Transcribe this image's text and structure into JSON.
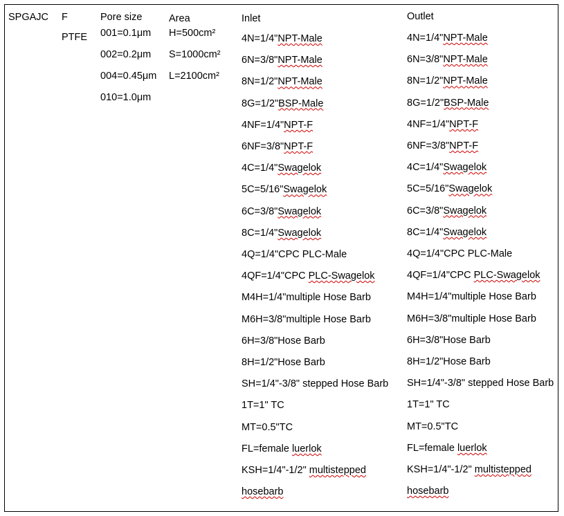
{
  "model": "SPGAJC",
  "material": {
    "code": "F",
    "name": "PTFE"
  },
  "pore_size": {
    "header": "Pore size",
    "items": [
      "001=0.1μm",
      "002=0.2μm",
      "004=0.45μm",
      "010=1.0μm"
    ]
  },
  "area": {
    "header": "Area",
    "items": [
      "H=500cm²",
      "S=1000cm²",
      "L=2100cm²"
    ]
  },
  "inlet": {
    "header": "Inlet",
    "items": [
      {
        "pre": "4N=1/4\"",
        "spell": "NPT-Male",
        "post": ""
      },
      {
        "pre": "6N=3/8\"",
        "spell": "NPT-Male",
        "post": ""
      },
      {
        "pre": "8N=1/2\"",
        "spell": "NPT-Male",
        "post": ""
      },
      {
        "pre": "8G=1/2\"",
        "spell": "BSP-Male",
        "post": ""
      },
      {
        "pre": "4NF=1/4\"",
        "spell": "NPT-F",
        "post": ""
      },
      {
        "pre": "6NF=3/8\"",
        "spell": "NPT-F",
        "post": ""
      },
      {
        "pre": "4C=1/4\"",
        "spell": "Swagelok",
        "post": ""
      },
      {
        "pre": "5C=5/16\"",
        "spell": "Swagelok",
        "post": ""
      },
      {
        "pre": "6C=3/8\"",
        "spell": "Swagelok",
        "post": ""
      },
      {
        "pre": "8C=1/4\"",
        "spell": "Swagelok",
        "post": ""
      },
      {
        "pre": "4Q=1/4\"CPC PLC-Male",
        "spell": "",
        "post": ""
      },
      {
        "pre": "4QF=1/4\"CPC ",
        "spell": "PLC-Swagelok",
        "post": ""
      },
      {
        "pre": "M4H=1/4\"multiple Hose Barb",
        "spell": "",
        "post": ""
      },
      {
        "pre": "M6H=3/8\"multiple Hose Barb",
        "spell": "",
        "post": ""
      },
      {
        "pre": "6H=3/8\"Hose Barb",
        "spell": "",
        "post": ""
      },
      {
        "pre": "8H=1/2\"Hose Barb",
        "spell": "",
        "post": ""
      },
      {
        "pre": "SH=1/4\"-3/8\" stepped Hose Barb",
        "spell": "",
        "post": ""
      },
      {
        "pre": "1T=1\" TC",
        "spell": "",
        "post": ""
      },
      {
        "pre": "MT=0.5\"TC",
        "spell": "",
        "post": ""
      },
      {
        "pre": "FL=female ",
        "spell": "luerlok",
        "post": ""
      },
      {
        "pre": "KSH=1/4\"-1/2\" ",
        "spell": "multistepped",
        "post": ""
      },
      {
        "pre": "",
        "spell": "hosebarb",
        "post": ""
      }
    ]
  },
  "outlet": {
    "header": "Outlet",
    "items": [
      {
        "pre": "4N=1/4\"",
        "spell": "NPT-Male",
        "post": ""
      },
      {
        "pre": "6N=3/8\"",
        "spell": "NPT-Male",
        "post": ""
      },
      {
        "pre": "8N=1/2\"",
        "spell": "NPT-Male",
        "post": ""
      },
      {
        "pre": "8G=1/2\"",
        "spell": "BSP-Male",
        "post": ""
      },
      {
        "pre": "4NF=1/4\"",
        "spell": "NPT-F",
        "post": ""
      },
      {
        "pre": "6NF=3/8\"",
        "spell": "NPT-F",
        "post": ""
      },
      {
        "pre": "4C=1/4\"",
        "spell": "Swagelok",
        "post": ""
      },
      {
        "pre": "5C=5/16\"",
        "spell": "Swagelok",
        "post": ""
      },
      {
        "pre": "6C=3/8\"",
        "spell": "Swagelok",
        "post": ""
      },
      {
        "pre": "8C=1/4\"",
        "spell": "Swagelok",
        "post": ""
      },
      {
        "pre": "4Q=1/4\"CPC PLC-Male",
        "spell": "",
        "post": ""
      },
      {
        "pre": "4QF=1/4\"CPC ",
        "spell": "PLC-Swagelok",
        "post": ""
      },
      {
        "pre": "M4H=1/4\"multiple Hose Barb",
        "spell": "",
        "post": ""
      },
      {
        "pre": "M6H=3/8\"multiple Hose Barb",
        "spell": "",
        "post": ""
      },
      {
        "pre": "6H=3/8\"Hose Barb",
        "spell": "",
        "post": ""
      },
      {
        "pre": "8H=1/2\"Hose Barb",
        "spell": "",
        "post": ""
      },
      {
        "pre": "SH=1/4\"-3/8\" stepped Hose Barb",
        "spell": "",
        "post": ""
      },
      {
        "pre": "1T=1\" TC",
        "spell": "",
        "post": ""
      },
      {
        "pre": "MT=0.5\"TC",
        "spell": "",
        "post": ""
      },
      {
        "pre": "FL=female ",
        "spell": "luerlok",
        "post": ""
      },
      {
        "pre": "KSH=1/4\"-1/2\" ",
        "spell": "multistepped",
        "post": ""
      },
      {
        "pre": "",
        "spell": "hosebarb",
        "post": ""
      }
    ]
  },
  "colors": {
    "border": "#000000",
    "text": "#000000",
    "spellcheck_underline": "#d00000"
  }
}
